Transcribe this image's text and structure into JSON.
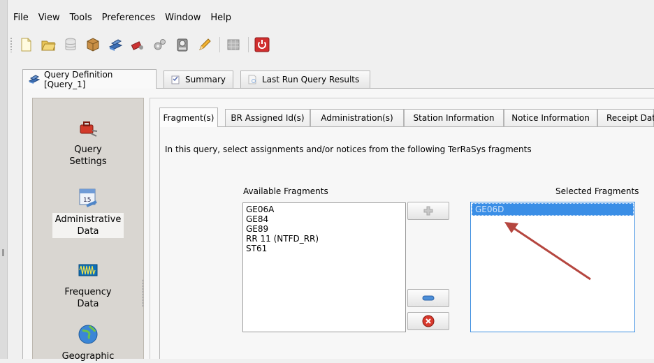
{
  "menubar": [
    "File",
    "View",
    "Tools",
    "Preferences",
    "Window",
    "Help"
  ],
  "toolbar": {
    "icons": [
      "new-document-icon",
      "open-folder-icon",
      "database-icon",
      "box-icon",
      "book-stack-icon",
      "tools-icon",
      "gears-icon",
      "calculator-icon",
      "pencil-icon",
      "grid-icon",
      "power-icon"
    ],
    "accent": "#d12f2f"
  },
  "top_tabs": [
    {
      "label": "Query Definition [Query_1]",
      "active": true
    },
    {
      "label": "Summary",
      "active": false
    },
    {
      "label": "Last Run Query Results",
      "active": false
    }
  ],
  "left_panel": [
    {
      "label_line1": "Query",
      "label_line2": "Settings",
      "icon": "toolbox-icon",
      "selected": false
    },
    {
      "label_line1": "Administrative",
      "label_line2": "Data",
      "icon": "calendar-icon",
      "selected": true
    },
    {
      "label_line1": "Frequency",
      "label_line2": "Data",
      "icon": "waveform-icon",
      "selected": false
    },
    {
      "label_line1": "Geographic",
      "label_line2": "",
      "icon": "globe-icon",
      "selected": false
    }
  ],
  "inner_tabs": [
    {
      "label": "Fragment(s)",
      "active": true
    },
    {
      "label": "BR Assigned Id(s)",
      "active": false
    },
    {
      "label": "Administration(s)",
      "active": false
    },
    {
      "label": "Station Information",
      "active": false
    },
    {
      "label": "Notice Information",
      "active": false
    },
    {
      "label": "Receipt Dat",
      "active": false
    }
  ],
  "fragments": {
    "description": "In this query, select assignments and/or notices from the following TerRaSys fragments",
    "available_label": "Available Fragments",
    "selected_label": "Selected Fragments",
    "available": [
      "GE06A",
      "GE84",
      "GE89",
      "RR 11 (NTFD_RR)",
      "ST61"
    ],
    "selected": [
      "GE06D"
    ]
  },
  "colors": {
    "selection": "#3a8ee6",
    "annotation_arrow": "#b5463f",
    "panel_bg": "#d9d6d1"
  }
}
